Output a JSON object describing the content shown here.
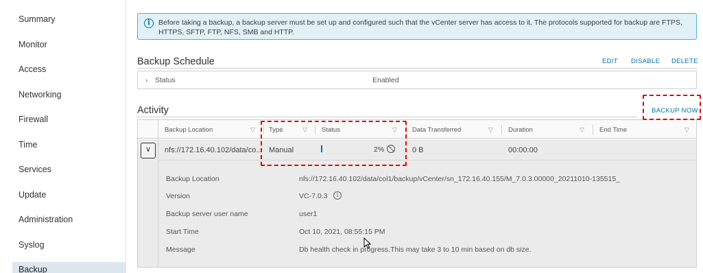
{
  "sidebar": {
    "items": [
      {
        "label": "Summary"
      },
      {
        "label": "Monitor"
      },
      {
        "label": "Access"
      },
      {
        "label": "Networking"
      },
      {
        "label": "Firewall"
      },
      {
        "label": "Time"
      },
      {
        "label": "Services"
      },
      {
        "label": "Update"
      },
      {
        "label": "Administration"
      },
      {
        "label": "Syslog"
      },
      {
        "label": "Backup"
      }
    ]
  },
  "banner": {
    "icon": "info-icon",
    "text": "Before taking a backup, a backup server must be set up and configured such that the vCenter server has access to it. The protocols supported for backup are FTPS, HTTPS, SFTP, FTP, NFS, SMB and HTTP."
  },
  "schedule": {
    "title": "Backup Schedule",
    "actions": {
      "edit": "EDIT",
      "disable": "DISABLE",
      "delete": "DELETE"
    },
    "status_label": "Status",
    "status_value": "Enabled"
  },
  "activity": {
    "title": "Activity",
    "backup_now": "BACKUP NOW",
    "columns": {
      "location": "Backup Location",
      "type": "Type",
      "status": "Status",
      "transferred": "Data Transferred",
      "duration": "Duration",
      "end_time": "End Time"
    },
    "row": {
      "location": "nfs://172.16.40.102/data/co...",
      "type": "Manual",
      "progress_percent": 2,
      "progress_text": "2%",
      "transferred": "0 B",
      "duration": "00:00:00",
      "end_time": ""
    },
    "details": {
      "location_label": "Backup Location",
      "location_value": "nfs://172.16.40.102/data/col1/backup/vCenter/sn_172.16.40.155/M_7.0.3.00000_20211010-135515_",
      "version_label": "Version",
      "version_value": "VC-7.0.3",
      "user_label": "Backup server user name",
      "user_value": "user1",
      "start_label": "Start Time",
      "start_value": "Oct 10, 2021, 08:55:15 PM",
      "message_label": "Message",
      "message_value": "Db health check in progress.This may take 3 to 10 min based on db size."
    }
  },
  "colors": {
    "accent": "#0072a3",
    "highlight": "#e00000",
    "banner_bg": "#e1f1f6"
  }
}
